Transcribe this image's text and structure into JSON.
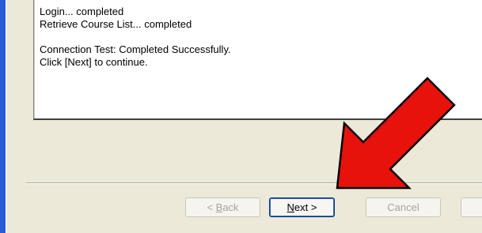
{
  "log": {
    "line1": "Login... completed",
    "line2": "Retrieve Course List... completed",
    "line3": "Connection Test: Completed Successfully.",
    "line4": "Click [Next] to continue."
  },
  "buttons": {
    "back_prefix": "< ",
    "back_mnemonic": "B",
    "back_rest": "ack",
    "next_mnemonic": "N",
    "next_rest": "ext >",
    "cancel_label": "Cancel"
  },
  "icons": {
    "arrow": "red-pointer-arrow-icon"
  },
  "colors": {
    "arrow_fill": "#e8120c",
    "window_bg": "#ece9d8",
    "xp_blue": "#2a5bd7"
  }
}
